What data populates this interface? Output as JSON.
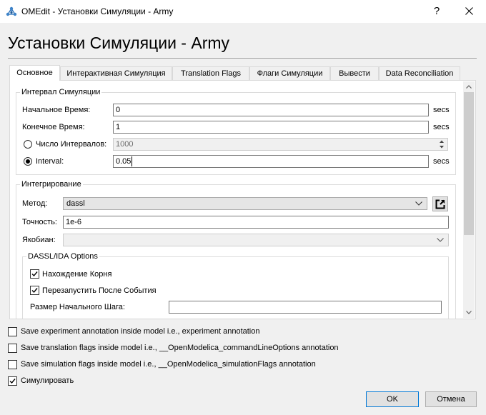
{
  "window": {
    "title": "OMEdit - Установки Симуляции - Army",
    "help": "?"
  },
  "heading": "Установки Симуляции - Army",
  "tabs": [
    {
      "label": "Основное",
      "selected": true
    },
    {
      "label": "Интерактивная Симуляция",
      "selected": false
    },
    {
      "label": "Translation Flags",
      "selected": false
    },
    {
      "label": "Флаги Симуляции",
      "selected": false
    },
    {
      "label": "Вывести",
      "selected": false
    },
    {
      "label": "Data Reconciliation",
      "selected": false
    }
  ],
  "interval": {
    "title": "Интервал Симуляции",
    "start": {
      "label": "Начальное Время:",
      "value": "0",
      "unit": "secs"
    },
    "stop": {
      "label": "Конечное Время:",
      "value": "1",
      "unit": "secs"
    },
    "number_of_intervals": {
      "label": "Число Интервалов:",
      "value": "1000",
      "selected": false
    },
    "interval": {
      "label": "Interval:",
      "value": "0.05",
      "unit": "secs",
      "selected": true
    }
  },
  "integration": {
    "title": "Интегрирование",
    "method": {
      "label": "Метод:",
      "value": "dassl"
    },
    "tolerance": {
      "label": "Точность:",
      "value": "1e-6"
    },
    "jacobian": {
      "label": "Якобиан:"
    }
  },
  "dassl": {
    "title": "DASSL/IDA Options",
    "root_finding": {
      "label": "Нахождение Корня",
      "checked": true
    },
    "restart_after_event": {
      "label": "Перезапустить После События",
      "checked": true
    },
    "initial_step_size": {
      "label": "Размер Начального Шага:"
    }
  },
  "footer": {
    "options": [
      {
        "label": "Save experiment annotation inside model i.e., experiment annotation",
        "checked": false
      },
      {
        "label": "Save translation flags inside model i.e., __OpenModelica_commandLineOptions annotation",
        "checked": false
      },
      {
        "label": "Save simulation flags inside model i.e., __OpenModelica_simulationFlags annotation",
        "checked": false
      },
      {
        "label": "Симулировать",
        "checked": true
      }
    ],
    "ok_label": "OK",
    "cancel_label": "Отмена"
  },
  "icons": {
    "app": "omedit-logo-icon",
    "close": "close-icon",
    "dropdown": "chevron-down-icon",
    "open_dialog": "open-external-icon",
    "check": "check-icon"
  },
  "colors": {
    "accent": "#0078d7",
    "window_bg": "#f0f0f0",
    "panel_bg": "#ffffff"
  }
}
